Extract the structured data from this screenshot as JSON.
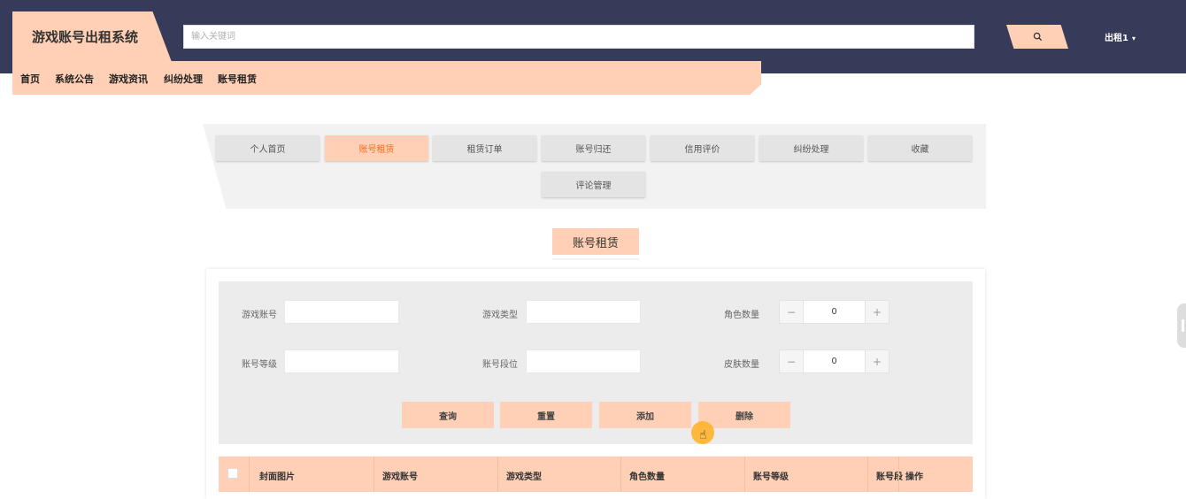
{
  "header": {
    "site_title": "游戏账号出租系统",
    "search_placeholder": "输入关键词",
    "user_label": "出租1"
  },
  "nav": [
    "首页",
    "系统公告",
    "游戏资讯",
    "纠纷处理",
    "账号租赁"
  ],
  "subnav": {
    "tabs": [
      "个人首页",
      "账号租赁",
      "租赁订单",
      "账号归还",
      "信用评价",
      "纠纷处理",
      "收藏",
      "评论管理"
    ],
    "active_tab": "账号租赁"
  },
  "section_title": "账号租赁",
  "form": {
    "game_account_label": "游戏账号",
    "game_type_label": "游戏类型",
    "role_count_label": "角色数量",
    "role_count_value": "0",
    "account_level_label": "账号等级",
    "account_rank_label": "账号段位",
    "skin_count_label": "皮肤数量",
    "skin_count_value": "0"
  },
  "actions": [
    "查询",
    "重置",
    "添加",
    "删除"
  ],
  "table": {
    "columns": [
      "封面图片",
      "游戏账号",
      "游戏类型",
      "角色数量",
      "账号等级",
      "账号段",
      "操作"
    ]
  },
  "colors": {
    "header_bg": "#353b58",
    "accent": "#ffd0b5",
    "active_text": "#ff6a1a"
  }
}
